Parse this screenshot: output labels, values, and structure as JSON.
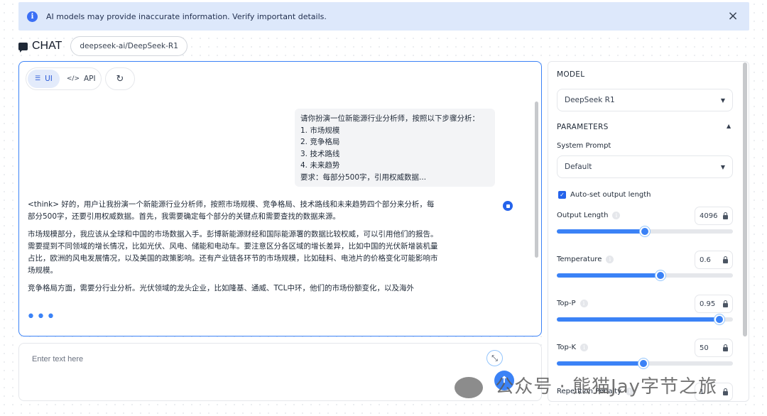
{
  "banner": {
    "icon": "info-icon",
    "text": "AI models may provide inaccurate information. Verify important details.",
    "close": "×"
  },
  "header": {
    "title": "CHAT",
    "model_pill": "deepseek-ai/DeepSeek-R1"
  },
  "toolbar": {
    "ui_label": "UI",
    "api_label": "API",
    "refresh_icon": "↻"
  },
  "conversation": {
    "user_lines": [
      "请你扮演一位新能源行业分析师，按照以下步骤分析：",
      "1. 市场规模",
      "2. 竞争格局",
      "3. 技术路线",
      "4. 未来趋势",
      "要求：每部分500字，引用权威数据..."
    ],
    "assistant_paragraphs": [
      "<think> 好的，用户让我扮演一个新能源行业分析师，按照市场规模、竞争格局、技术路线和未来趋势四个部分来分析，每部分500字，还要引用权威数据。首先，我需要确定每个部分的关键点和需要查找的数据来源。",
      "市场规模部分，我应该从全球和中国的市场数据入手。彭博新能源财经和国际能源署的数据比较权威，可以引用他们的报告。需要提到不同领域的增长情况，比如光伏、风电、储能和电动车。要注意区分各区域的增长差异，比如中国的光伏新增装机量占比，欧洲的风电发展情况，以及美国的政策影响。还有产业链各环节的市场规模，比如硅料、电池片的价格变化可能影响市场规模。",
      "竞争格局方面，需要分行业分析。光伏领域的龙头企业，比如隆基、通威、TCL中环，他们的市场份额变化，以及海外"
    ],
    "typing_dots": "•••"
  },
  "input": {
    "placeholder": "Enter text here",
    "value": ""
  },
  "panel": {
    "model_section": "MODEL",
    "model_value": "DeepSeek R1",
    "params_section": "PARAMETERS",
    "system_prompt_label": "System Prompt",
    "system_prompt_value": "Default",
    "auto_set_label": "Auto-set output length",
    "auto_set_checked": true,
    "params": [
      {
        "label": "Output Length",
        "value": "4096",
        "fraction": 0.5
      },
      {
        "label": "Temperature",
        "value": "0.6",
        "fraction": 0.59
      },
      {
        "label": "Top-P",
        "value": "0.95",
        "fraction": 0.925
      },
      {
        "label": "Top-K",
        "value": "50",
        "fraction": 0.49
      },
      {
        "label": "Repetition Penalty",
        "value": "1"
      }
    ]
  },
  "watermark": "公众号 · 熊猫Jay字节之旅",
  "colors": {
    "accent": "#3b82f6",
    "banner_bg": "#dde8fb"
  }
}
